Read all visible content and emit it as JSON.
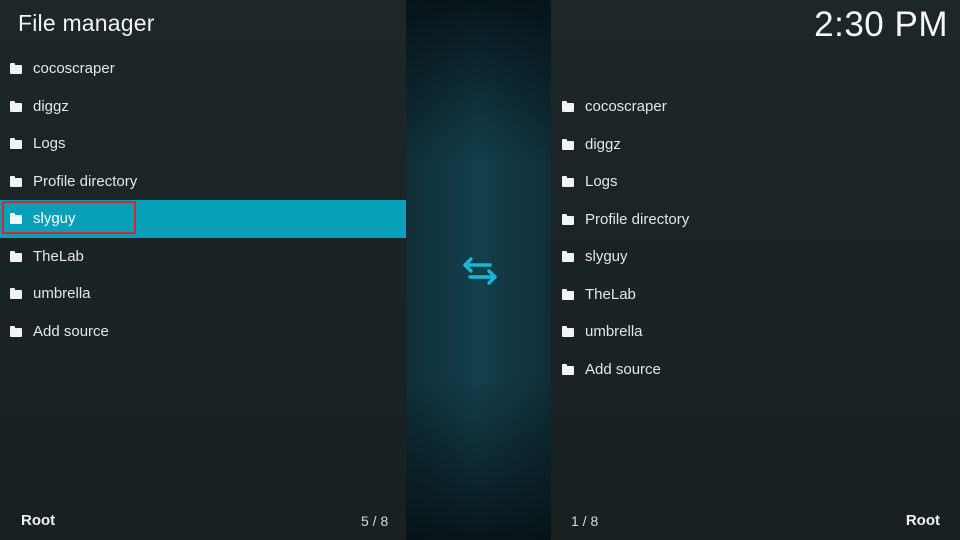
{
  "header": {
    "title": "File manager",
    "clock": "2:30 PM"
  },
  "left_panel": {
    "items": [
      {
        "label": "cocoscraper"
      },
      {
        "label": "diggz"
      },
      {
        "label": "Logs"
      },
      {
        "label": "Profile directory"
      },
      {
        "label": "slyguy",
        "selected": true
      },
      {
        "label": "TheLab"
      },
      {
        "label": "umbrella"
      },
      {
        "label": "Add source"
      }
    ],
    "footer_label": "Root",
    "footer_count": "5 / 8"
  },
  "right_panel": {
    "items": [
      {
        "label": "cocoscraper"
      },
      {
        "label": "diggz"
      },
      {
        "label": "Logs"
      },
      {
        "label": "Profile directory"
      },
      {
        "label": "slyguy"
      },
      {
        "label": "TheLab"
      },
      {
        "label": "umbrella"
      },
      {
        "label": "Add source"
      }
    ],
    "footer_label": "Root",
    "footer_count": "1 / 8"
  },
  "icons": {
    "item_icon": "folder-icon",
    "swap_icon": "swap-arrows-icon"
  },
  "colors": {
    "accent": "#08a0b8",
    "focus_border": "#d9252c",
    "swap_icon": "#19b6d6"
  }
}
